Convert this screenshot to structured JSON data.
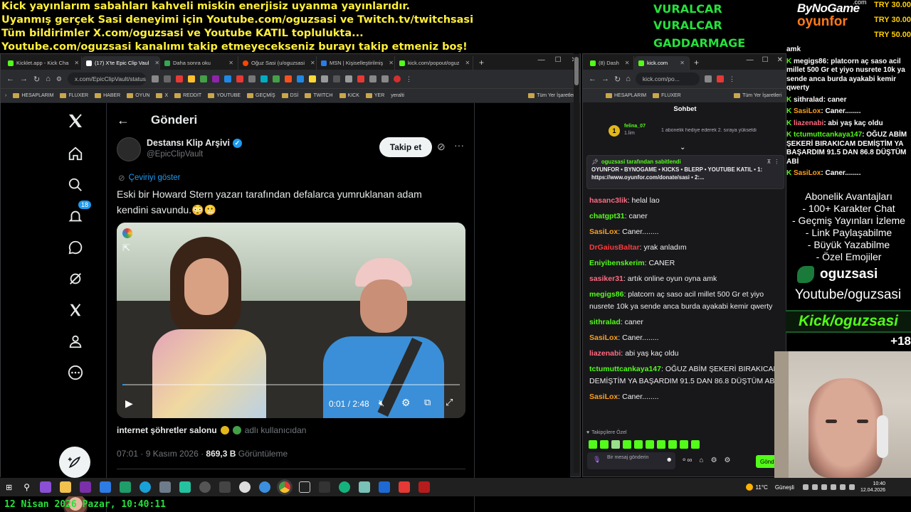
{
  "overlay": {
    "ticker": [
      "Kick yayınlarım sabahları kahveli miskin enerjisiz uyanma yayınlarıdır.",
      "Uyanmış gerçek Sasi deneyimi için Youtube.com/oguzsasi ve Twitch.tv/twitchsasi",
      "Tüm bildirimler X.com/oguzsasi ve Youtube KATIL toplulukta...",
      "Youtube.com/oguzsasi kanalımı takip etmeyecekseniz burayı takip etmeniz boş!"
    ],
    "names": [
      "VURALCAR",
      "VURALCAR",
      "GADDARMAGE"
    ],
    "brand_top": "ByNoGame",
    "brand_com": ".com",
    "brand_bottom": "oyunfor",
    "donations": [
      "TRY 30.00",
      "TRY 30.00",
      "TRY 50.00"
    ],
    "date": "12 Nisan 2026 Pazar, 10:40:11"
  },
  "left_browser": {
    "tabs": [
      {
        "label": "Kicklet.app - Kick Cha",
        "color": "#53fc18"
      },
      {
        "label": "(17) X'te Epic Clip Vaul",
        "color": "#ffffff"
      },
      {
        "label": "Daha sonra oku",
        "color": "#34a853"
      },
      {
        "label": "Oğuz Sasi (u/oguzsasi",
        "color": "#ff4500"
      },
      {
        "label": "MSN | Kişiselleştirilmiş",
        "color": "#2d7be5"
      },
      {
        "label": "kick.com/popout/oguz",
        "color": "#53fc18"
      }
    ],
    "url": "x.com/EpicClipVault/status/20...",
    "bookmarks": [
      "HESAPLARIM",
      "FLUXER",
      "HABER",
      "OYUN",
      "X",
      "REDDIT",
      "YOUTUBE",
      "GEÇMİŞ",
      "DSİ",
      "TWITCH",
      "KICK",
      "YER",
      "yeralti",
      "Tüm Yer İşaretleri"
    ]
  },
  "x_post": {
    "header": "Gönderi",
    "badge_count": "18",
    "author_name": "Destansı Klip Arşivi",
    "author_handle": "@EpicClipVault",
    "follow_label": "Takip et",
    "translate_label": "Çeviriyi göster",
    "text": "Eski bir Howard Stern yazarı tarafından defalarca yumruklanan adam kendini savundu.😳😬",
    "video_time": "0:01 / 2:48",
    "source_account": "internet şöhretler salonu",
    "source_suffix": "adlı kullanıcıdan",
    "time": "07:01 · 9 Kasım 2026 · ",
    "views_count": "869,3 B",
    "views_label": " Görüntüleme"
  },
  "right_browser": {
    "tabs": [
      {
        "label": "(8) Dash",
        "color": "#53fc18"
      },
      {
        "label": "kick.com",
        "color": "#53fc18"
      }
    ],
    "url": "kick.com/po...",
    "bookmarks": [
      "HESAPLARIM",
      "FLUXER",
      "Tüm Yer İşaretleri"
    ]
  },
  "kick_chat": {
    "title": "Sohbet",
    "gift_user": "felina_07",
    "gift_text": "1 abonelik hediye ederek 2. sıraya yükseldi",
    "gift_rank": "1",
    "gift_level": "1.lim",
    "pinned_by": "oguzsasi tarafından sabitlendi",
    "pinned_text": "OYUNFOR • BYNOGAME • KICKS • BLERP • YOUTUBE KATIL • 1: https://www.oyunfor.com/donate/sasi • 2:...",
    "messages": [
      {
        "user": "hasanc3lik",
        "color": "#ff6b81",
        "text": "helal lao"
      },
      {
        "user": "chatgpt31",
        "color": "#53fc18",
        "text": "caner"
      },
      {
        "user": "SasiLox",
        "color": "#ff9f1a",
        "text": "Caner........"
      },
      {
        "user": "DrGaiusBaltar",
        "color": "#ff3b3b",
        "text": "yrak anladım"
      },
      {
        "user": "Eniyibenskerim",
        "color": "#53fc18",
        "text": "CANER"
      },
      {
        "user": "sasiker31",
        "color": "#ff6b81",
        "text": "artık online oyun oyna amk"
      },
      {
        "user": "megigs86",
        "color": "#53fc18",
        "text": "platcorn aç saso acil millet 500 Gr et yiyo nusrete 10k ya sende anca burda ayakabi kemir qwerty"
      },
      {
        "user": "sithralad",
        "color": "#53fc18",
        "text": "caner"
      },
      {
        "user": "SasiLox",
        "color": "#ff9f1a",
        "text": "Caner........"
      },
      {
        "user": "liazenabi",
        "color": "#ff6b81",
        "text": "abi yaş kaç oldu"
      },
      {
        "user": "tctumuttcankaya147",
        "color": "#53fc18",
        "text": "OĞUZ ABİM ŞEKERİ BIRAKICAM DEMİŞTİM YA BAŞARDIM 91.5 DAN 86.8 DÜŞTÜM ABİ"
      },
      {
        "user": "SasiLox",
        "color": "#ff9f1a",
        "text": "Caner........"
      }
    ],
    "emote_label": "Takipçilere Özel",
    "input_placeholder": "Bir mesaj gönderin",
    "send_label": "Gönd"
  },
  "side_chat": [
    {
      "user": "amk",
      "color": "#ffffff",
      "text": ""
    },
    {
      "user": "megigs86",
      "color": "#ffffff",
      "text": ": platcorn aç saso acil millet 500 Gr et yiyo nusrete 10k ya sende anca burda ayakabi kemir qwerty"
    },
    {
      "user": "sithralad",
      "color": "#ffffff",
      "text": ": caner"
    },
    {
      "user": "SasiLox",
      "color": "#ff9f1a",
      "text": ": Caner........"
    },
    {
      "user": "liazenabi",
      "color": "#ff6b81",
      "text": ": abi yaş kaç oldu"
    },
    {
      "user": "tctumuttcankaya147",
      "color": "#53fc18",
      "text": ": OĞUZ ABİM ŞEKERİ BIRAKICAM DEMİŞTİM YA BAŞARDIM 91.5 DAN 86.8 DÜŞTÜM ABİ"
    },
    {
      "user": "SasiLox",
      "color": "#ff9f1a",
      "text": ": Caner........"
    }
  ],
  "perks": {
    "lines": [
      "Abonelik Avantajları",
      "- 100+ Karakter Chat",
      "- Geçmiş Yayınları İzleme",
      "- Link Paylaşabilme",
      "- Büyük Yazabilme",
      "- Özel Emojiler"
    ],
    "kick_name": "oguzsasi",
    "youtube": "Youtube/oguzsasi",
    "kick_banner": "Kick/oguzsasi",
    "plus_count": "+18"
  },
  "taskbar": {
    "weather": "11°C",
    "weather_label": "Güneşli",
    "time": "10:40",
    "date": "12.04.2026"
  },
  "colors": {
    "kick_green": "#53fc18",
    "x_blue": "#1d9bf0",
    "ticker_yellow": "#ffef3a",
    "overlay_green": "#26e03c"
  }
}
